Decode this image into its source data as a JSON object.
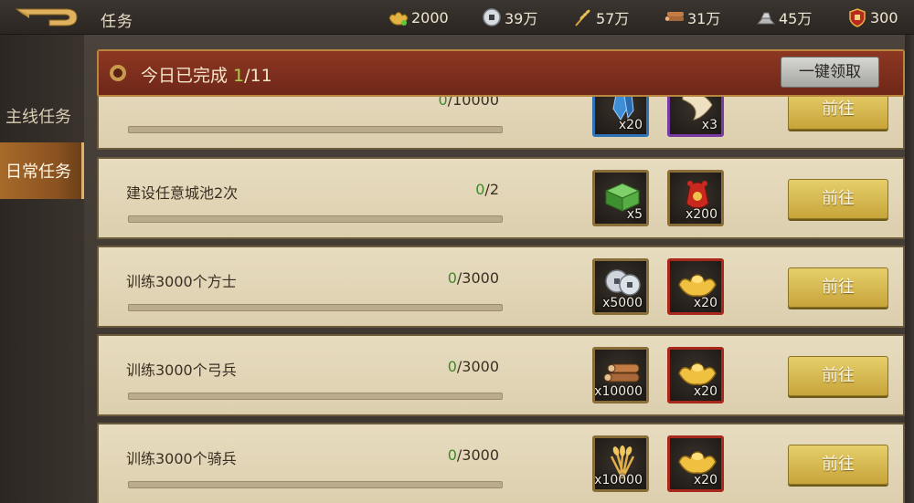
{
  "header": {
    "title": "任务",
    "resources": [
      {
        "icon": "gold-ingot-icon",
        "value": "2000"
      },
      {
        "icon": "silver-coin-icon",
        "value": "39万"
      },
      {
        "icon": "grain-icon",
        "value": "57万"
      },
      {
        "icon": "wood-icon",
        "value": "31万"
      },
      {
        "icon": "iron-icon",
        "value": "45万"
      },
      {
        "icon": "honor-badge-icon",
        "value": "300"
      }
    ]
  },
  "sidebar": {
    "items": [
      {
        "label": "主线任务",
        "active": false
      },
      {
        "label": "日常任务",
        "active": true
      }
    ]
  },
  "summary": {
    "prefix": "今日已完成 ",
    "done": "1",
    "suffix": "/11",
    "claim_all": "一键领取"
  },
  "tasks": [
    {
      "name": "",
      "progress_current": "0",
      "progress_total": "/10000",
      "progress_fraction": 0,
      "rewards": [
        {
          "icon": "blue-crystal-icon",
          "qty": "x20",
          "frame": "blue"
        },
        {
          "icon": "horn-icon",
          "qty": "x3",
          "frame": "purple"
        }
      ],
      "button": "前往"
    },
    {
      "name": "建设任意城池2次",
      "progress_current": "0",
      "progress_total": "/2",
      "progress_fraction": 0,
      "rewards": [
        {
          "icon": "green-chest-icon",
          "qty": "x5",
          "frame": "gold"
        },
        {
          "icon": "red-pouch-icon",
          "qty": "x200",
          "frame": "gold"
        }
      ],
      "button": "前往"
    },
    {
      "name": "训练3000个方士",
      "progress_current": "0",
      "progress_total": "/3000",
      "progress_fraction": 0,
      "rewards": [
        {
          "icon": "silver-coins-icon",
          "qty": "x5000",
          "frame": "gold"
        },
        {
          "icon": "gold-ingot-icon",
          "qty": "x20",
          "frame": "red"
        }
      ],
      "button": "前往"
    },
    {
      "name": "训练3000个弓兵",
      "progress_current": "0",
      "progress_total": "/3000",
      "progress_fraction": 0,
      "rewards": [
        {
          "icon": "wood-logs-icon",
          "qty": "x10000",
          "frame": "gold"
        },
        {
          "icon": "gold-ingot-icon",
          "qty": "x20",
          "frame": "red"
        }
      ],
      "button": "前往"
    },
    {
      "name": "训练3000个骑兵",
      "progress_current": "0",
      "progress_total": "/3000",
      "progress_fraction": 0,
      "rewards": [
        {
          "icon": "grain-bundle-icon",
          "qty": "x10000",
          "frame": "gold"
        },
        {
          "icon": "gold-ingot-icon",
          "qty": "x20",
          "frame": "red"
        }
      ],
      "button": "前往"
    }
  ]
}
